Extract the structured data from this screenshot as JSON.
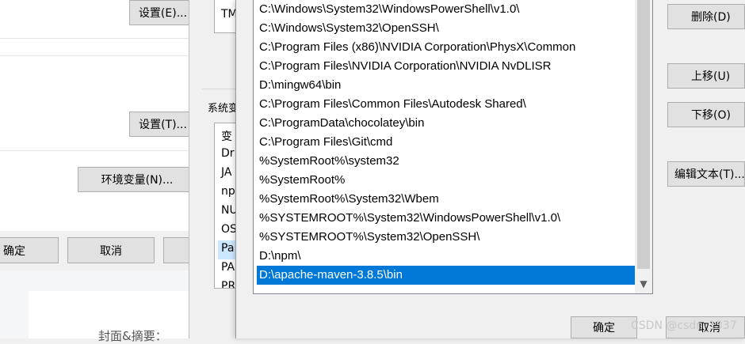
{
  "system_properties": {
    "settings_button_e": "设置(E)...",
    "settings_button_t": "设置(T)...",
    "env_vars_button": "环境变量(N)...",
    "ok_button": "确定",
    "cancel_button": "取消"
  },
  "env_vars_dialog": {
    "user_list_visible_cell": "TM",
    "system_group_label": "系统变",
    "system_list_cells": [
      "变",
      "Dr",
      "JA",
      "np",
      "NU",
      "OS",
      "Pa",
      "PA",
      "PR"
    ]
  },
  "edit_path_dialog": {
    "path_entries": [
      "C:\\Windows\\System32\\WindowsPowerShell\\v1.0\\",
      "C:\\Windows\\System32\\OpenSSH\\",
      "C:\\Program Files (x86)\\NVIDIA Corporation\\PhysX\\Common",
      "C:\\Program Files\\NVIDIA Corporation\\NVIDIA NvDLISR",
      "D:\\mingw64\\bin",
      "C:\\Program Files\\Common Files\\Autodesk Shared\\",
      "C:\\ProgramData\\chocolatey\\bin",
      "C:\\Program Files\\Git\\cmd",
      "%SystemRoot%\\system32",
      "%SystemRoot%",
      "%SystemRoot%\\System32\\Wbem",
      "%SYSTEMROOT%\\System32\\WindowsPowerShell\\v1.0\\",
      "%SYSTEMROOT%\\System32\\OpenSSH\\",
      "D:\\npm\\",
      "D:\\apache-maven-3.8.5\\bin"
    ],
    "selected_entry": "D:\\apache-maven-3.8.5\\bin",
    "delete_button": "删除(D)",
    "move_up_button": "上移(U)",
    "move_down_button": "下移(O)",
    "edit_text_button": "编辑文本(T)...",
    "ok_button": "确定",
    "cancel_button": "取消"
  },
  "background_page": {
    "cover_label": "封面&摘要："
  },
  "watermark": "CSDN @csdn_1337",
  "colors": {
    "selection": "#0078d7",
    "button_face": "#e1e1e1",
    "dialog_face": "#f0f0f0"
  }
}
